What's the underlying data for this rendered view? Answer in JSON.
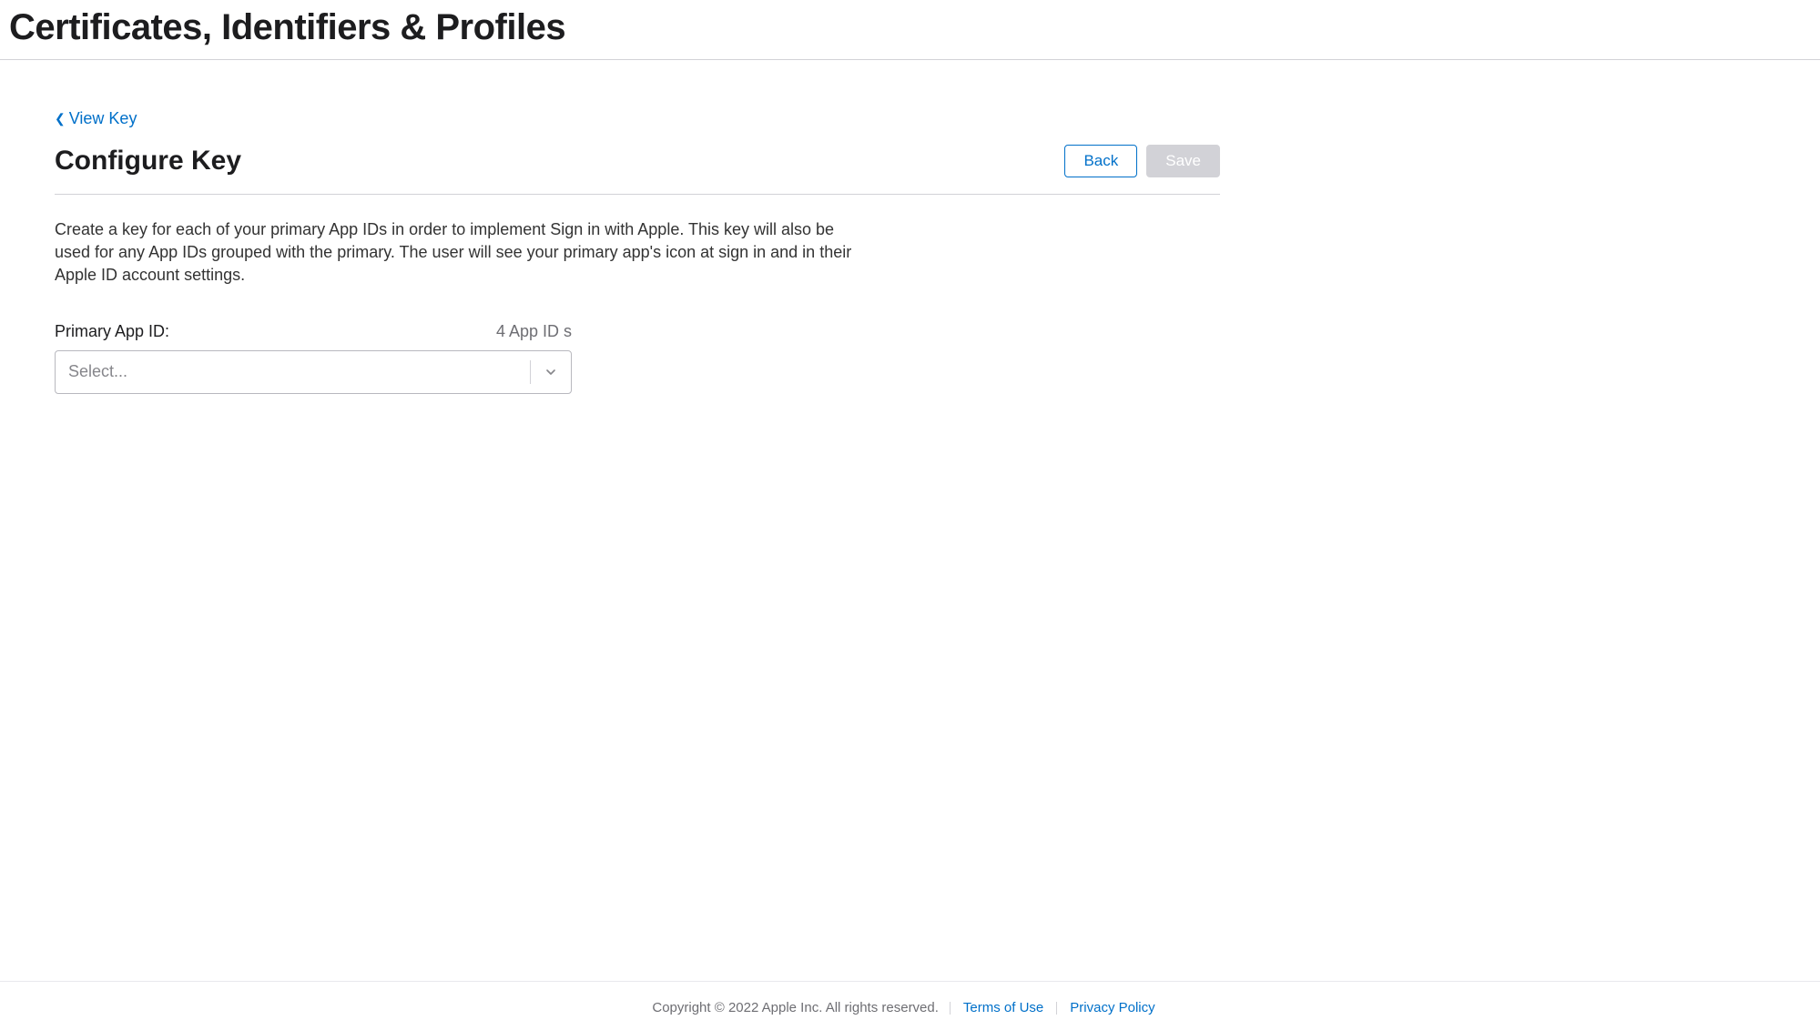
{
  "header": {
    "title": "Certificates, Identifiers & Profiles"
  },
  "breadcrumb": {
    "back_label": "View Key"
  },
  "section": {
    "title": "Configure Key",
    "back_button": "Back",
    "save_button": "Save",
    "description": "Create a key for each of your primary App IDs in order to implement Sign in with Apple. This key will also be used for any App IDs grouped with the primary. The user will see your primary app's icon at sign in and in their Apple ID account settings."
  },
  "form": {
    "primary_app_id_label": "Primary App ID:",
    "app_id_count": "4 App ID s",
    "select_placeholder": "Select..."
  },
  "footer": {
    "copyright": "Copyright © 2022 Apple Inc. All rights reserved.",
    "terms_label": "Terms of Use",
    "privacy_label": "Privacy Policy"
  }
}
